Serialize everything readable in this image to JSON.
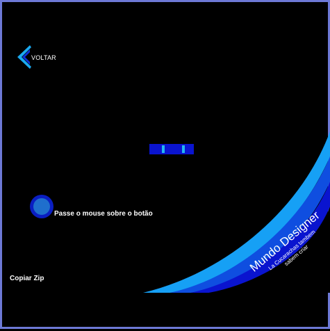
{
  "nav": {
    "back_label": "VOLTAR",
    "back_icon": "chevron-left-icon"
  },
  "slider": {
    "handle_positions": [
      0.31,
      0.77
    ]
  },
  "hover_demo": {
    "hint": "Passe o mouse sobre o botão"
  },
  "footer": {
    "copy_label": "Copiar Zip"
  },
  "brand": {
    "title": "Mundo Designer",
    "tagline_line1": "La Cucarachas tambem",
    "tagline_line2": "sabem criar"
  },
  "colors": {
    "background": "#000000",
    "frame_border": "#6d79d6",
    "accent_blue": "#0a14cf",
    "light_cyan": "#22b8f0",
    "sky_blue": "#16a0f5",
    "deep_blue": "#0a1ec2",
    "button_inner": "#1f6fcd"
  }
}
